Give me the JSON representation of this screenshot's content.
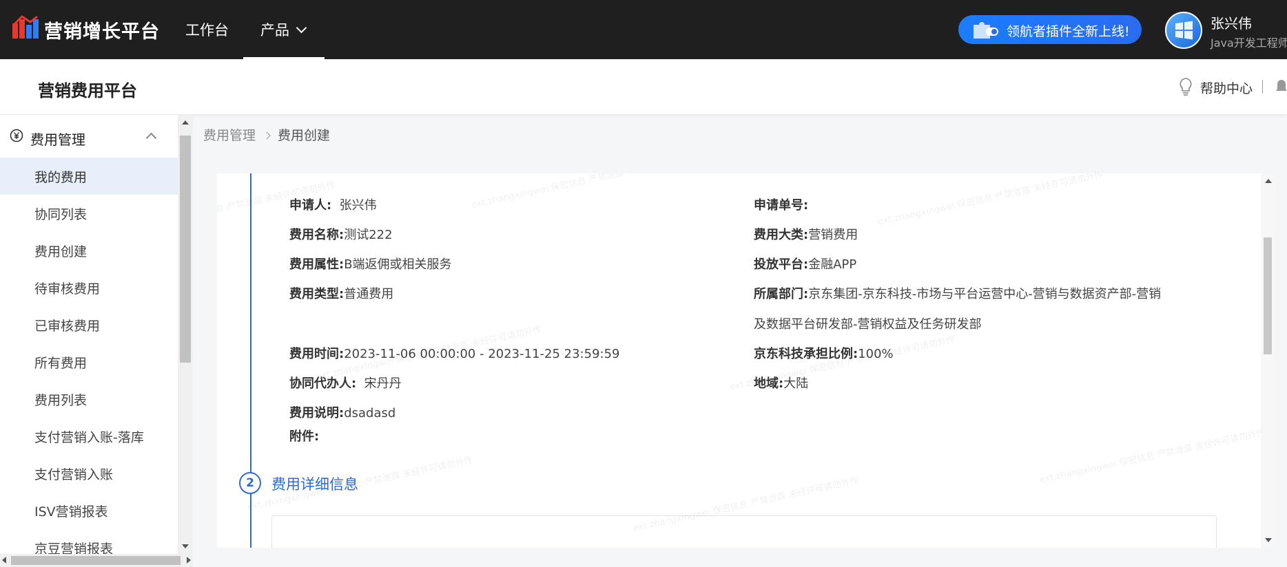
{
  "topbar": {
    "brand": "营销增长平台",
    "nav": [
      "工作台",
      "产品"
    ],
    "promo": "领航者插件全新上线!",
    "user_name": "张兴伟",
    "user_role": "Java开发工程师"
  },
  "subheader": {
    "title": "营销费用平台",
    "help": "帮助中心"
  },
  "sidebar": {
    "group_label": "费用管理",
    "items": [
      {
        "label": "我的费用",
        "active": true
      },
      {
        "label": "协同列表"
      },
      {
        "label": "费用创建"
      },
      {
        "label": "待审核费用"
      },
      {
        "label": "已审核费用"
      },
      {
        "label": "所有费用"
      },
      {
        "label": "费用列表"
      },
      {
        "label": "支付营销入账-落库"
      },
      {
        "label": "支付营销入账"
      },
      {
        "label": "ISV营销报表"
      },
      {
        "label": "京豆营销报表"
      }
    ]
  },
  "breadcrumb": [
    "费用管理",
    "费用创建"
  ],
  "detail": {
    "left": [
      {
        "label": "申请人:",
        "value": "张兴伟"
      },
      {
        "label": "费用名称:",
        "value": "测试222"
      },
      {
        "label": "费用属性:",
        "value": "B端返佣或相关服务"
      },
      {
        "label": "费用类型:",
        "value": "普通费用"
      },
      {
        "label": "费用时间:",
        "value": "2023-11-06 00:00:00 - 2023-11-25 23:59:59"
      },
      {
        "label": "协同代办人:",
        "value": "宋丹丹"
      },
      {
        "label": "费用说明:",
        "value": "dsadasd"
      },
      {
        "label": "附件:",
        "value": ""
      }
    ],
    "right": [
      {
        "label": "申请单号:",
        "value": ""
      },
      {
        "label": "费用大类:",
        "value": "营销费用"
      },
      {
        "label": "投放平台:",
        "value": "金融APP"
      },
      {
        "label": "所属部门:",
        "value": "京东集团-京东科技-市场与平台运营中心-营销与数据资产部-营销",
        "value2": "及数据平台研发部-营销权益及任务研发部"
      },
      {
        "label": "京东科技承担比例:",
        "value": "100%"
      },
      {
        "label": "地域:",
        "value": "大陆"
      }
    ]
  },
  "section2": {
    "number": "2",
    "title": "费用详细信息"
  },
  "watermark": "ext.zhangxingwei 保密信息 严禁泄露 未经许可请勿外传",
  "colors": {
    "accent": "#2f6bd8",
    "topbar": "#1f1f1f",
    "active_bg": "#e8effb"
  }
}
